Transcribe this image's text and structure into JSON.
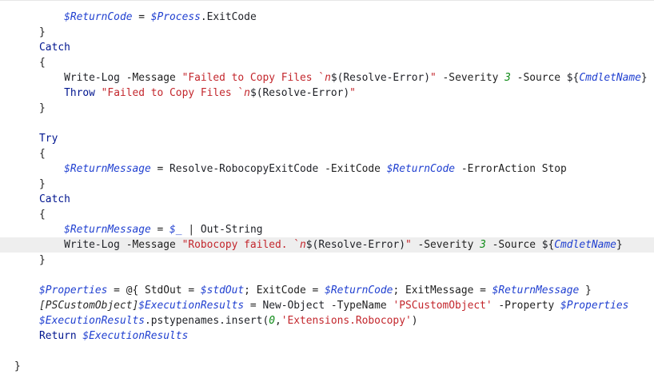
{
  "editor": {
    "colors": {
      "background": "#ffffff",
      "highlight_line": "#eeeeee",
      "variable": "#1f3fd0",
      "keyword": "#00158f",
      "string": "#c3262c",
      "number": "#0e8a16",
      "text": "#1e1e1e"
    },
    "highlighted_line": 15,
    "lines": [
      [
        [
          "        ",
          "plain"
        ],
        [
          "$ReturnCode",
          "var"
        ],
        [
          " = ",
          "op"
        ],
        [
          "$Process",
          "var"
        ],
        [
          ".ExitCode",
          "cmd"
        ]
      ],
      [
        [
          "    ",
          "plain"
        ],
        [
          "}",
          "brace"
        ]
      ],
      [
        [
          "    ",
          "plain"
        ],
        [
          "Catch",
          "kw"
        ]
      ],
      [
        [
          "    ",
          "plain"
        ],
        [
          "{",
          "brace"
        ]
      ],
      [
        [
          "        ",
          "plain"
        ],
        [
          "Write-Log",
          "cmd"
        ],
        [
          " -Message ",
          "param"
        ],
        [
          "\"Failed to Copy Files `",
          "str"
        ],
        [
          "n",
          "esc"
        ],
        [
          "$(Resolve-Error)",
          "cmd"
        ],
        [
          "\"",
          "str"
        ],
        [
          " -Severity ",
          "param"
        ],
        [
          "3",
          "num"
        ],
        [
          " -Source ",
          "param"
        ],
        [
          "${",
          "cmd"
        ],
        [
          "CmdletName",
          "var"
        ],
        [
          "}",
          "cmd"
        ]
      ],
      [
        [
          "        ",
          "plain"
        ],
        [
          "Throw",
          "kw"
        ],
        [
          " ",
          "plain"
        ],
        [
          "\"Failed to Copy Files `",
          "str"
        ],
        [
          "n",
          "esc"
        ],
        [
          "$(Resolve-Error)",
          "cmd"
        ],
        [
          "\"",
          "str"
        ]
      ],
      [
        [
          "    ",
          "plain"
        ],
        [
          "}",
          "brace"
        ]
      ],
      [
        [
          "",
          "plain"
        ]
      ],
      [
        [
          "    ",
          "plain"
        ],
        [
          "Try",
          "kw"
        ]
      ],
      [
        [
          "    ",
          "plain"
        ],
        [
          "{",
          "brace"
        ]
      ],
      [
        [
          "        ",
          "plain"
        ],
        [
          "$ReturnMessage",
          "var"
        ],
        [
          " = ",
          "op"
        ],
        [
          "Resolve-RobocopyExitCode",
          "cmd"
        ],
        [
          " -ExitCode ",
          "param"
        ],
        [
          "$ReturnCode",
          "var"
        ],
        [
          " -ErrorAction Stop",
          "param"
        ]
      ],
      [
        [
          "    ",
          "plain"
        ],
        [
          "}",
          "brace"
        ]
      ],
      [
        [
          "    ",
          "plain"
        ],
        [
          "Catch",
          "kw"
        ]
      ],
      [
        [
          "    ",
          "plain"
        ],
        [
          "{",
          "brace"
        ]
      ],
      [
        [
          "        ",
          "plain"
        ],
        [
          "$ReturnMessage",
          "var"
        ],
        [
          " = ",
          "op"
        ],
        [
          "$_",
          "var"
        ],
        [
          " | ",
          "op"
        ],
        [
          "Out-String",
          "cmd"
        ]
      ],
      [
        [
          "        ",
          "plain"
        ],
        [
          "Write-Log",
          "cmd"
        ],
        [
          " -Message ",
          "param"
        ],
        [
          "\"Robocopy failed. `",
          "str"
        ],
        [
          "n",
          "esc"
        ],
        [
          "$(Resolve-Error)",
          "cmd"
        ],
        [
          "\"",
          "str"
        ],
        [
          " -Severity ",
          "param"
        ],
        [
          "3",
          "num"
        ],
        [
          " -Source ",
          "param"
        ],
        [
          "${",
          "cmd"
        ],
        [
          "CmdletName",
          "var"
        ],
        [
          "}",
          "cmd"
        ]
      ],
      [
        [
          "    ",
          "plain"
        ],
        [
          "}",
          "brace"
        ]
      ],
      [
        [
          "",
          "plain"
        ]
      ],
      [
        [
          "    ",
          "plain"
        ],
        [
          "$Properties",
          "var"
        ],
        [
          " = @{ StdOut = ",
          "op"
        ],
        [
          "$stdOut",
          "var"
        ],
        [
          "; ExitCode = ",
          "op"
        ],
        [
          "$ReturnCode",
          "var"
        ],
        [
          "; ExitMessage = ",
          "op"
        ],
        [
          "$ReturnMessage",
          "var"
        ],
        [
          " }",
          "op"
        ]
      ],
      [
        [
          "    ",
          "plain"
        ],
        [
          "[PSCustomObject]",
          "type"
        ],
        [
          "$ExecutionResults",
          "var"
        ],
        [
          " = ",
          "op"
        ],
        [
          "New-Object",
          "cmd"
        ],
        [
          " -TypeName ",
          "param"
        ],
        [
          "'PSCustomObject'",
          "str"
        ],
        [
          " -Property ",
          "param"
        ],
        [
          "$Properties",
          "var"
        ]
      ],
      [
        [
          "    ",
          "plain"
        ],
        [
          "$ExecutionResults",
          "var"
        ],
        [
          ".pstypenames.insert(",
          "cmd"
        ],
        [
          "0",
          "num"
        ],
        [
          ",",
          "op"
        ],
        [
          "'Extensions.Robocopy'",
          "str"
        ],
        [
          ")",
          "op"
        ]
      ],
      [
        [
          "    ",
          "plain"
        ],
        [
          "Return",
          "kw"
        ],
        [
          " ",
          "plain"
        ],
        [
          "$ExecutionResults",
          "var"
        ]
      ],
      [
        [
          "",
          "plain"
        ]
      ],
      [
        [
          "}",
          "brace"
        ]
      ]
    ]
  }
}
